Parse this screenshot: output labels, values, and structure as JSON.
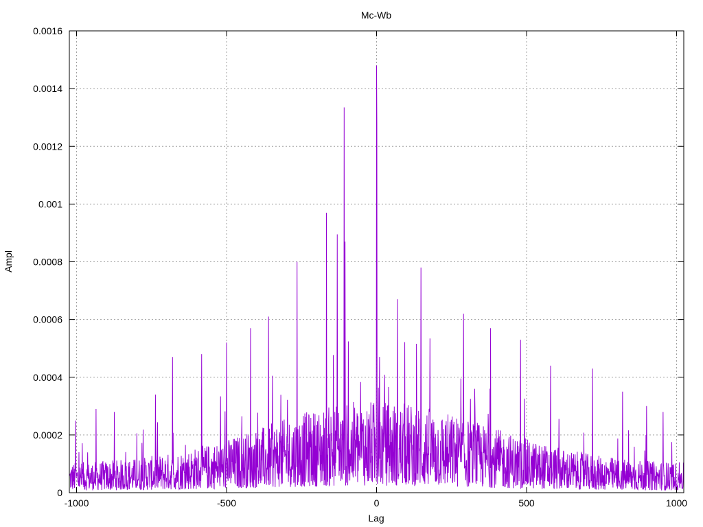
{
  "chart_data": {
    "type": "line",
    "title": "Mc-Wb",
    "xlabel": "Lag",
    "ylabel": "Ampl",
    "xlim": [
      -1024,
      1024
    ],
    "ylim": [
      0,
      0.0016
    ],
    "x_ticks": [
      -1000,
      -500,
      0,
      500,
      1000
    ],
    "x_tick_labels": [
      "-1000",
      "-500",
      "0",
      "500",
      "1000"
    ],
    "y_ticks": [
      0,
      0.0002,
      0.0004,
      0.0006,
      0.0008,
      0.001,
      0.0012,
      0.0014,
      0.0016
    ],
    "y_tick_labels": [
      "0",
      "0.0002",
      "0.0004",
      "0.0006",
      "0.0008",
      "0.001",
      "0.0012",
      "0.0014",
      "0.0016"
    ],
    "grid": true,
    "color": "#9400d3",
    "peaks": [
      {
        "x": 0,
        "y": 0.00148
      },
      {
        "x": 1,
        "y": 0.00128
      },
      {
        "x": -108,
        "y": 0.001335
      },
      {
        "x": -167,
        "y": 0.00097
      },
      {
        "x": -131,
        "y": 0.000895
      },
      {
        "x": -105,
        "y": 0.00087
      },
      {
        "x": -265,
        "y": 0.0008
      },
      {
        "x": 148,
        "y": 0.00078
      },
      {
        "x": 70,
        "y": 0.00067
      },
      {
        "x": -360,
        "y": 0.00061
      },
      {
        "x": 290,
        "y": 0.00062
      },
      {
        "x": -500,
        "y": 0.00052
      },
      {
        "x": -680,
        "y": 0.00047
      },
      {
        "x": -583,
        "y": 0.00048
      },
      {
        "x": 720,
        "y": 0.00043
      },
      {
        "x": 480,
        "y": 0.00053
      },
      {
        "x": 900,
        "y": 0.0003
      },
      {
        "x": 955,
        "y": 0.00028
      },
      {
        "x": -935,
        "y": 0.00029
      },
      {
        "x": -1003,
        "y": 0.00025
      },
      {
        "x": -874,
        "y": 0.00028
      },
      {
        "x": -737,
        "y": 0.00034
      },
      {
        "x": 580,
        "y": 0.00044
      },
      {
        "x": 820,
        "y": 0.00035
      },
      {
        "x": -420,
        "y": 0.00057
      },
      {
        "x": 380,
        "y": 0.00057
      }
    ]
  }
}
